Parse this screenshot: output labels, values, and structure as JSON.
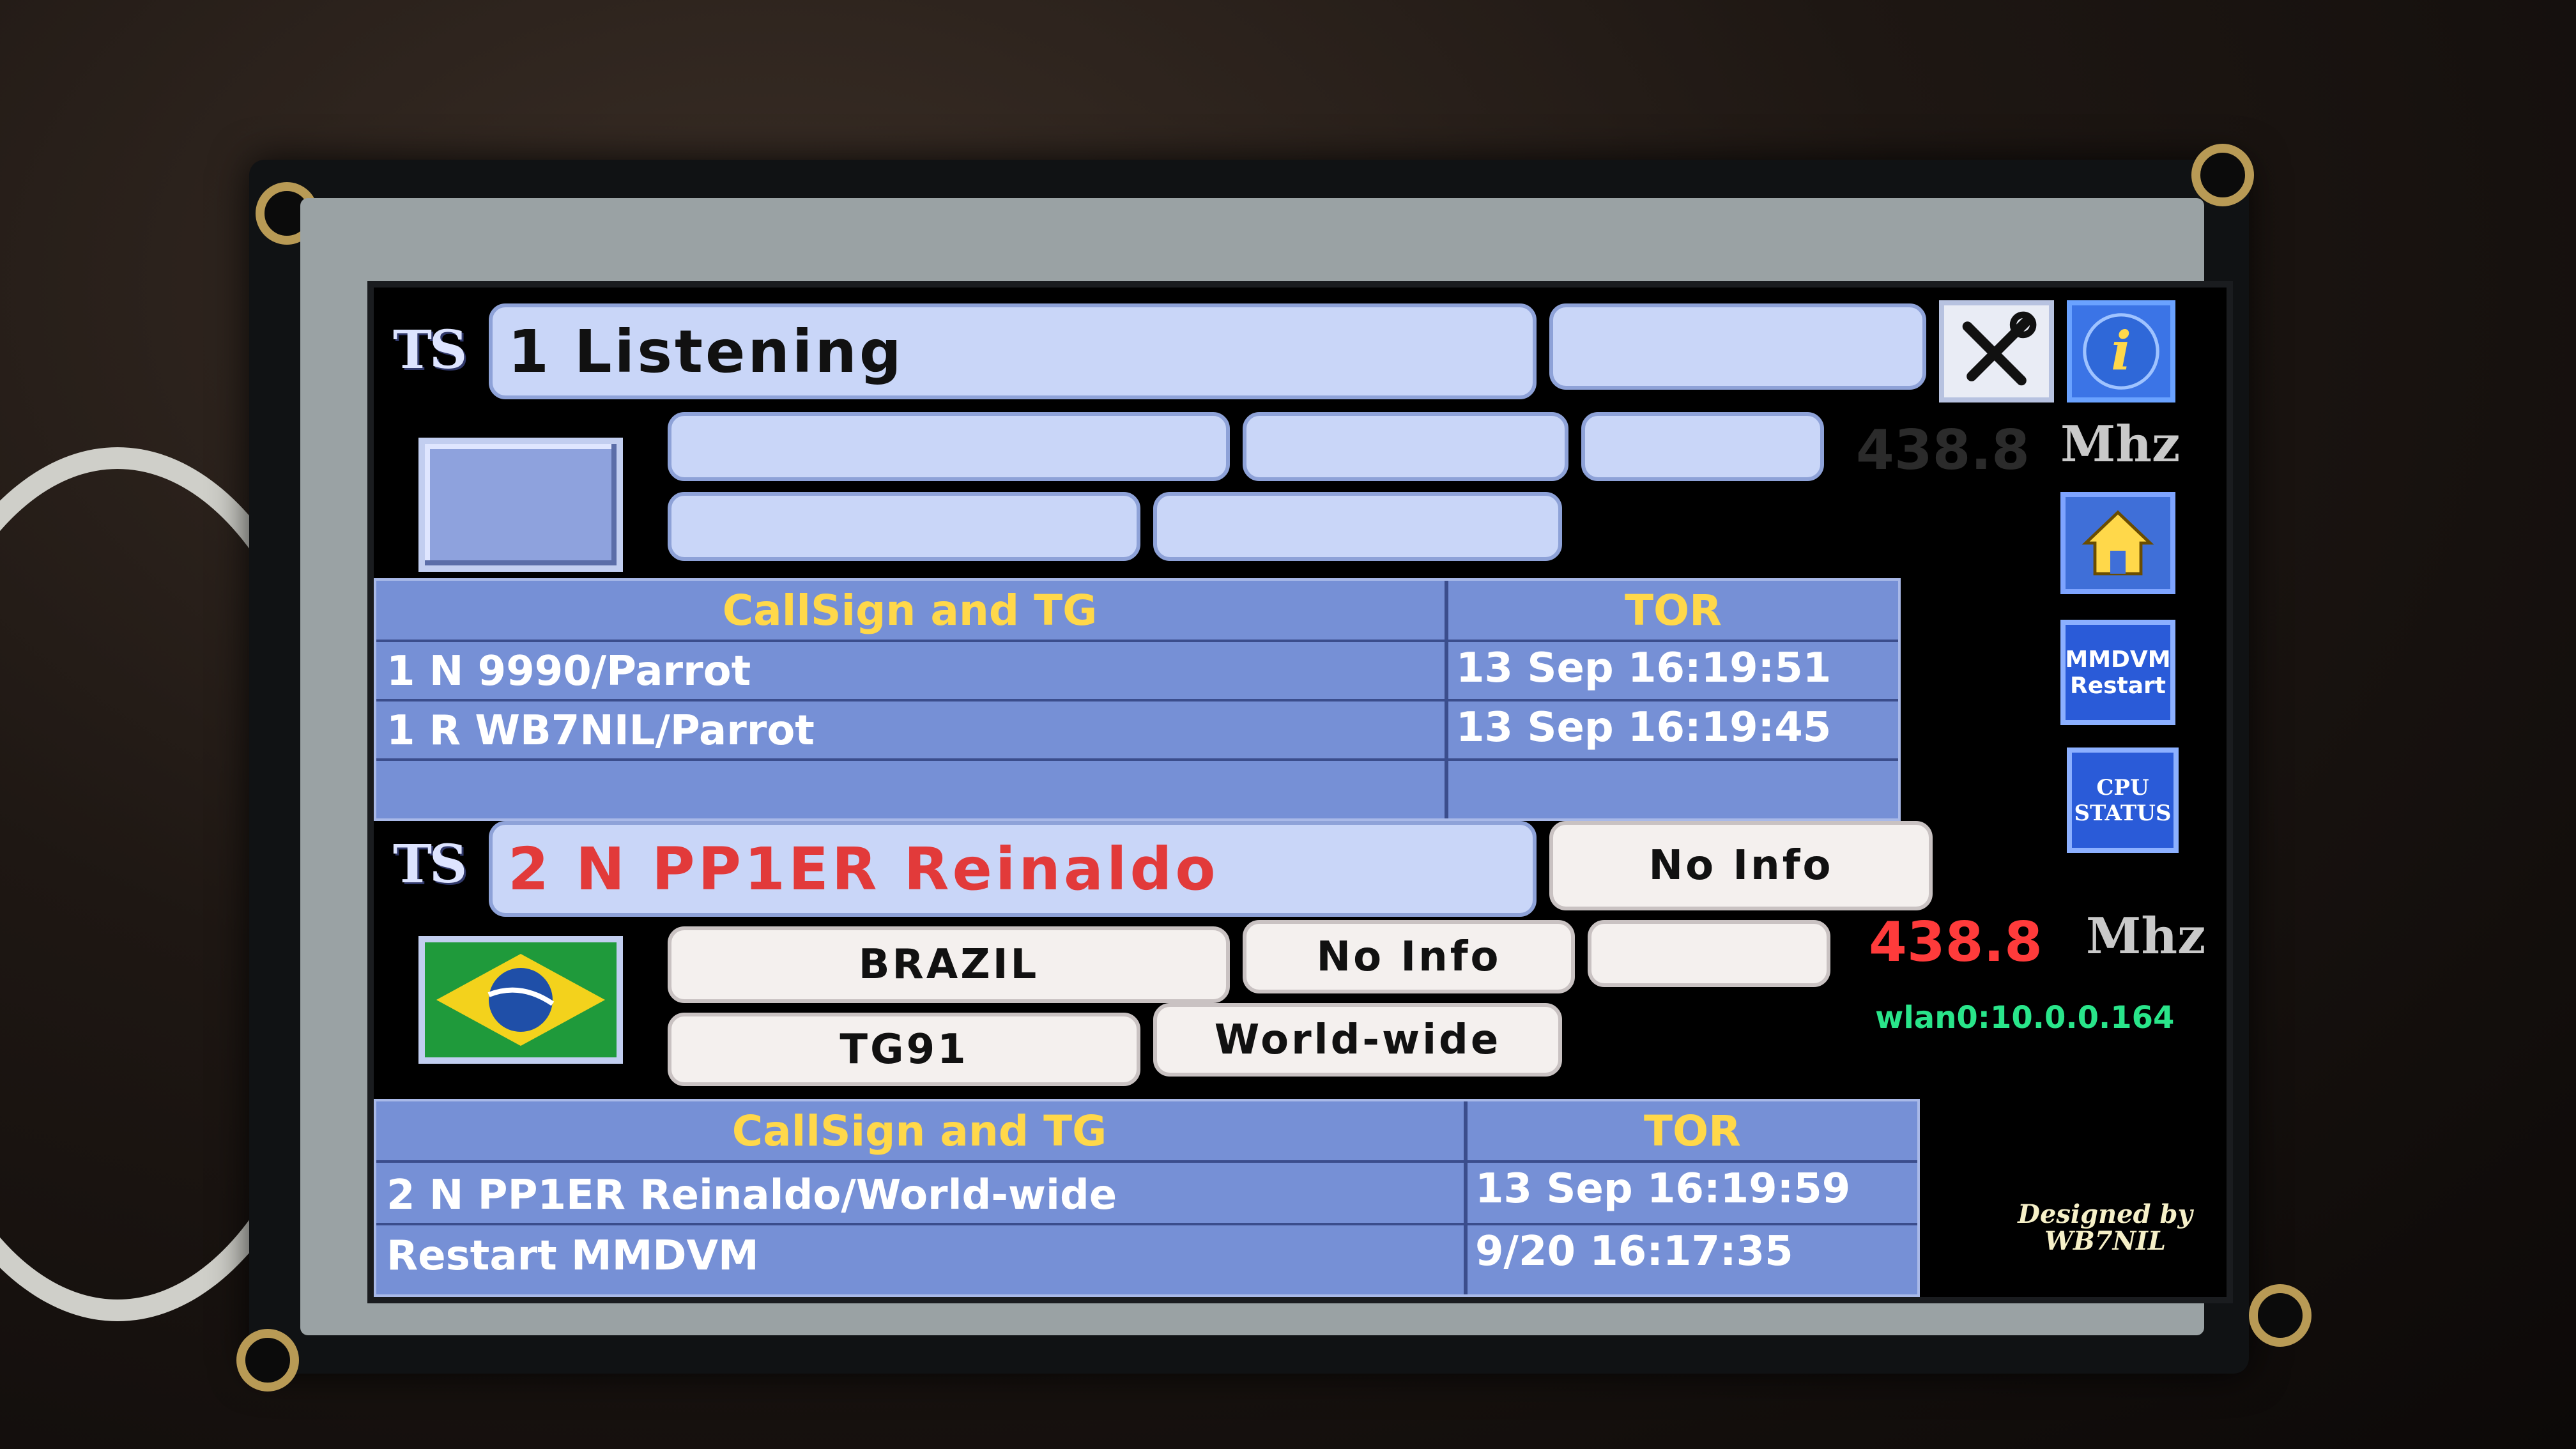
{
  "colors": {
    "accent_yellow": "#ffd84a",
    "table_blue": "#7690d6",
    "freq_red": "#ff3b3b",
    "wlan_green": "#29e58a"
  },
  "slot1": {
    "ts_label": "TS",
    "status": "1 Listening",
    "frequency": "438.8",
    "unit": "Mhz",
    "table": {
      "headers": [
        "CallSign and TG",
        "TOR"
      ],
      "rows": [
        {
          "call": "1 N 9990/Parrot",
          "tor": "13 Sep 16:19:51"
        },
        {
          "call": "1 R WB7NIL/Parrot",
          "tor": "13 Sep 16:19:45"
        }
      ]
    }
  },
  "slot2": {
    "ts_label": "TS",
    "status": "2 N PP1ER Reinaldo",
    "info": "No Info",
    "country": "BRAZIL",
    "info2": "No Info",
    "talkgroup": "TG91",
    "region": "World-wide",
    "flag_icon": "brazil-flag-icon",
    "frequency": "438.8",
    "unit": "Mhz",
    "network": "wlan0:10.0.0.164",
    "table": {
      "headers": [
        "CallSign and TG",
        "TOR"
      ],
      "rows": [
        {
          "call": "2 N PP1ER Reinaldo/World-wide",
          "tor": "13 Sep 16:19:59"
        },
        {
          "call": "Restart MMDVM",
          "tor": "9/20 16:17:35"
        }
      ]
    }
  },
  "side_buttons": {
    "tools_icon": "tools-icon",
    "info_icon": "info-icon",
    "home_icon": "home-icon",
    "mmdvm_line1": "MMDVM",
    "mmdvm_line2": "Restart",
    "cpu_line1": "CPU",
    "cpu_line2": "STATUS"
  },
  "footer": {
    "line1": "Designed by",
    "line2": "WB7NIL"
  }
}
